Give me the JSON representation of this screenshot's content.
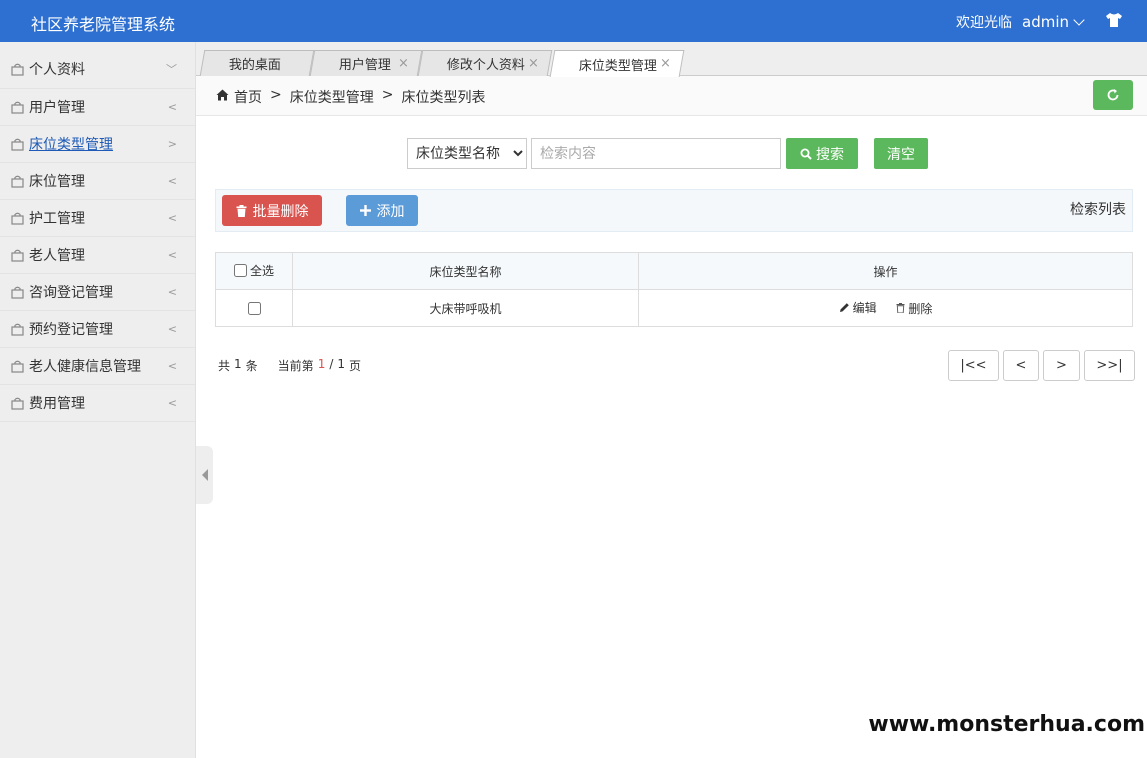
{
  "header": {
    "app_title": "社区养老院管理系统",
    "welcome": "欢迎光临",
    "username": "admin",
    "shirt_icon": "shirt-icon"
  },
  "sidebar": {
    "items": [
      {
        "label": "个人资料",
        "arrow": "﹀"
      },
      {
        "label": "用户管理",
        "arrow": "<"
      },
      {
        "label": "床位类型管理",
        "arrow": ">"
      },
      {
        "label": "床位管理",
        "arrow": "<"
      },
      {
        "label": "护工管理",
        "arrow": "<"
      },
      {
        "label": "老人管理",
        "arrow": "<"
      },
      {
        "label": "咨询登记管理",
        "arrow": "<"
      },
      {
        "label": "预约登记管理",
        "arrow": "<"
      },
      {
        "label": "老人健康信息管理",
        "arrow": "<"
      },
      {
        "label": "费用管理",
        "arrow": "<"
      }
    ],
    "active_index": 2
  },
  "tabs": [
    {
      "label": "我的桌面"
    },
    {
      "label": "用户管理",
      "close": "×"
    },
    {
      "label": "修改个人资料",
      "close": "×"
    },
    {
      "label": "床位类型管理",
      "close": "×"
    }
  ],
  "breadcrumb": {
    "home": "首页",
    "sep": ">",
    "level1": "床位类型管理",
    "level2": "床位类型列表"
  },
  "search": {
    "field_selected": "床位类型名称",
    "placeholder": "检索内容",
    "search_label": "搜索",
    "clear_label": "清空"
  },
  "toolbar": {
    "batch_delete_label": "批量删除",
    "add_label": "添加",
    "list_title": "检索列表"
  },
  "table": {
    "select_all": "全选",
    "col_name": "床位类型名称",
    "col_ops": "操作",
    "rows": [
      {
        "name": "大床带呼吸机"
      }
    ],
    "edit_label": "编辑",
    "delete_label": "删除"
  },
  "pager": {
    "total_prefix": "共",
    "total": "1",
    "total_suffix": "条",
    "current_prefix": "当前第",
    "current": "1",
    "slash": "/",
    "pages": "1",
    "pages_suffix": "页",
    "first": "|<<",
    "prev": "<",
    "next": ">",
    "last": ">>|"
  },
  "watermark": "www.monsterhua.com",
  "colors": {
    "header_bg": "#2e70d1",
    "green": "#5cb85c",
    "red": "#d9534f",
    "blue": "#5b9bd8"
  }
}
